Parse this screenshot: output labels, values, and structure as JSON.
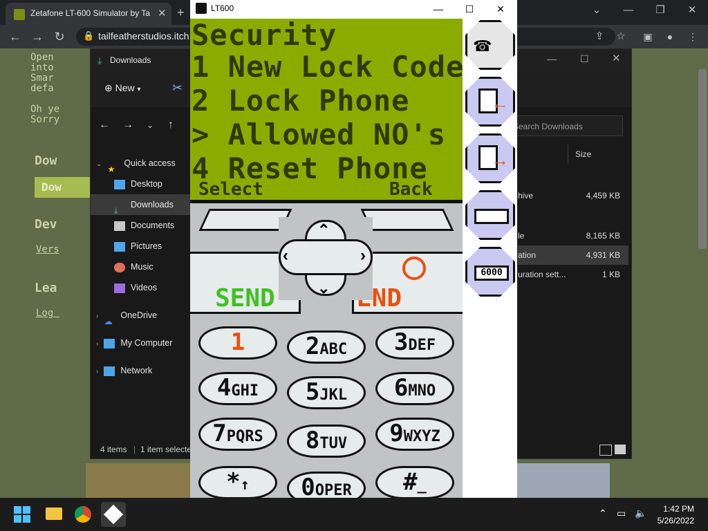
{
  "chrome": {
    "tab_title": "Zetafone LT-600 Simulator by Ta",
    "tab_close": "✕",
    "new_tab": "+",
    "url": "tailfeatherstudios.itch",
    "controls": {
      "minimize": "⌄",
      "min2": "—",
      "restore": "❐",
      "close": "✕"
    }
  },
  "page": {
    "text_lines": [
      "Open",
      "into",
      "Smar",
      "defa",
      "",
      "Oh ye",
      "Sorry"
    ],
    "heading1": "Dow",
    "heading2": "Dev",
    "link1": "Vers",
    "heading3": "Lea",
    "link2": "Log ",
    "button_partial": "Dow"
  },
  "explorer": {
    "title": "Downloads",
    "new_label": "New",
    "search_placeholder": "Search Downloads",
    "col_size": "Size",
    "sidebar": [
      {
        "label": "Quick access",
        "icon": "star-icon",
        "color": "#f5c518"
      },
      {
        "label": "Desktop",
        "icon": "desktop-icon",
        "color": "#4ea6e8"
      },
      {
        "label": "Downloads",
        "icon": "download-icon",
        "color": "#3fbf8c"
      },
      {
        "label": "Documents",
        "icon": "document-icon",
        "color": "#c8c8c8"
      },
      {
        "label": "Pictures",
        "icon": "pictures-icon",
        "color": "#4ea6e8"
      },
      {
        "label": "Music",
        "icon": "music-icon",
        "color": "#e0705a"
      },
      {
        "label": "Videos",
        "icon": "videos-icon",
        "color": "#9b6be0"
      },
      {
        "label": "OneDrive",
        "icon": "cloud-icon",
        "color": "#3a8ee6"
      },
      {
        "label": "My Computer",
        "icon": "computer-icon",
        "color": "#4ea6e8"
      },
      {
        "label": "Network",
        "icon": "network-icon",
        "color": "#4ea6e8"
      }
    ],
    "files": [
      {
        "name": "hive",
        "size": "4,459 KB"
      },
      {
        "name": "le",
        "size": "8,165 KB"
      },
      {
        "name": "ation",
        "size": "4,931 KB"
      },
      {
        "name": "uration sett...",
        "size": "1 KB"
      }
    ],
    "status_count": "4 items",
    "status_selected": "1 item selecte"
  },
  "sim": {
    "title": "LT600",
    "lcd_lines": [
      "Security",
      "1 New Lock Code",
      "2 Lock Phone",
      "> Allowed NO's",
      "4 Reset Phone"
    ],
    "soft_left": "Select",
    "soft_right": "Back",
    "send_label": "SEND",
    "end_label": "END",
    "send_color": "#40c020",
    "end_color": "#e85010",
    "keys": [
      {
        "num": "1",
        "letters": ""
      },
      {
        "num": "2",
        "letters": "ABC"
      },
      {
        "num": "3",
        "letters": "DEF"
      },
      {
        "num": "4",
        "letters": "GHI"
      },
      {
        "num": "5",
        "letters": "JKL"
      },
      {
        "num": "6",
        "letters": "MNO"
      },
      {
        "num": "7",
        "letters": "PQRS"
      },
      {
        "num": "8",
        "letters": "TUV"
      },
      {
        "num": "9",
        "letters": "WXYZ"
      },
      {
        "num": "*",
        "letters": "↑"
      },
      {
        "num": "0",
        "letters": "OPER"
      },
      {
        "num": "#",
        "letters": "_"
      }
    ],
    "side_buttons": [
      "phone-setup-icon",
      "save-load-icon",
      "save-out-icon",
      "battery-icon",
      "score-icon"
    ],
    "side_battery_text": "",
    "side_score_text": "6000"
  },
  "taskbar": {
    "time": "1:42 PM",
    "date": "5/26/2022"
  }
}
